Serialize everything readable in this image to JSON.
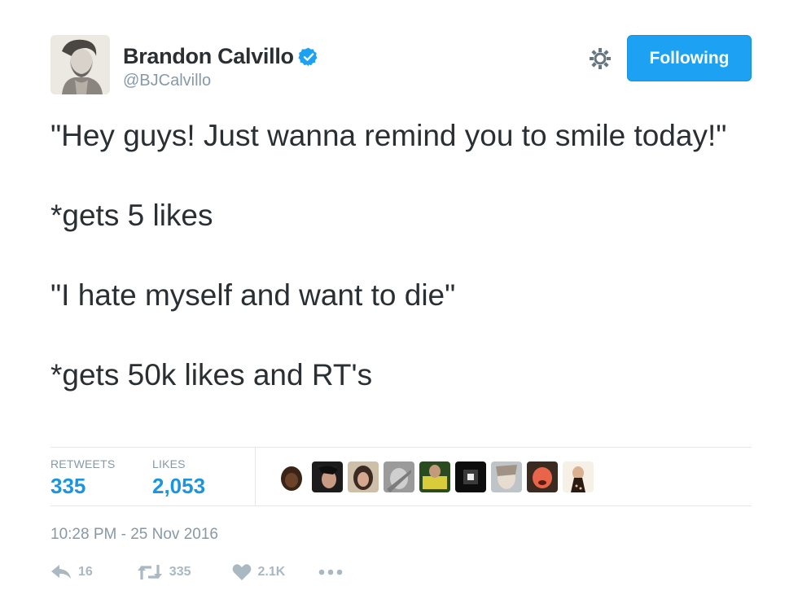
{
  "user": {
    "display_name": "Brandon Calvillo",
    "handle": "@BJCalvillo",
    "verified_icon": "verified-badge-icon",
    "follow_label": "Following"
  },
  "tweet": {
    "lines": [
      "\"Hey guys! Just wanna remind you to smile today!\"",
      "*gets 5 likes",
      "\"I hate myself and want to die\"",
      "*gets 50k likes and RT's"
    ]
  },
  "stats": {
    "retweets_label": "RETWEETS",
    "retweets_value": "335",
    "likes_label": "LIKES",
    "likes_value": "2,053"
  },
  "timestamp": "10:28 PM - 25 Nov 2016",
  "actions": {
    "reply_count": "16",
    "retweet_count": "335",
    "like_count": "2.1K"
  },
  "colors": {
    "accent": "#1da1f2",
    "stat_value": "#1b95e0",
    "muted": "#8899a6",
    "action_icon": "#aab8c2"
  }
}
